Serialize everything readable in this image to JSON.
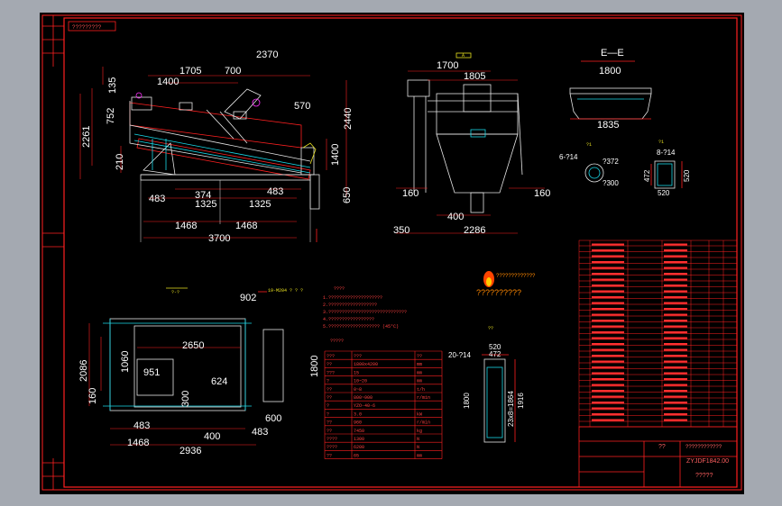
{
  "drawing": {
    "top_left_label": "?????????",
    "drawing_no": "ZYJDF1842.00",
    "title_question": "??",
    "company_question": "????????????",
    "bottom_question": "?????",
    "logo_caption": "??????????",
    "logo_top": "?????????????",
    "tech_title": "????",
    "tech_lines": [
      "1.????????????????????",
      "2.??????????????????",
      "3.?????????????????????????????",
      "4.?????????????????",
      "5.???????????????????  (45°C)"
    ],
    "params_title": "?????",
    "params_rows": [
      [
        "???",
        "???",
        "??"
      ],
      [
        "??",
        "1800x4200",
        "mm"
      ],
      [
        "???",
        "15",
        "mm"
      ],
      [
        "?",
        "10~20",
        "mm"
      ],
      [
        "??",
        "0~8",
        "t/h"
      ],
      [
        "??",
        "800~900",
        "r/min"
      ],
      [
        "?",
        "YZO-40-6",
        ""
      ],
      [
        "?",
        "3.0",
        "kW"
      ],
      [
        "??",
        "960",
        "r/min"
      ],
      [
        "??",
        "7450",
        "kg"
      ],
      [
        "????",
        "1300",
        "N"
      ],
      [
        "????",
        "6200",
        "N"
      ],
      [
        "??",
        "65",
        "mm"
      ]
    ]
  },
  "views": {
    "main_dims": [
      "1400",
      "1705",
      "700",
      "2370",
      "135",
      "752",
      "2261",
      "210",
      "570",
      "2440",
      "1400",
      "650",
      "483",
      "374",
      "1325",
      "1325",
      "483",
      "1468",
      "1468",
      "3700"
    ],
    "side_title": "A",
    "side_dims": [
      "1700",
      "1805",
      "160",
      "160",
      "400",
      "350",
      "2286"
    ],
    "ee_title": "E—E",
    "ee_dims": [
      "1800",
      "1835"
    ],
    "detail_titles": [
      "?1",
      "?1",
      "?2"
    ],
    "detail_dims": [
      "6-?14",
      "?372",
      "?300",
      "8-?14",
      "472",
      "520",
      "520"
    ],
    "plan_title": "?-?",
    "plan_note": "19-M204 ? ? ?",
    "plan_dims": [
      "902",
      "2650",
      "951",
      "624",
      "300",
      "1060",
      "2086",
      "160",
      "1800",
      "483",
      "400",
      "600",
      "483",
      "1468",
      "2936"
    ],
    "right_box_title": "??",
    "right_box_dims": [
      "20-?14",
      "520",
      "472",
      "1800",
      "23x8=1864",
      "1916"
    ]
  },
  "colors": {
    "background": "#000000",
    "frame": "#ff2020",
    "dimension_text": "#ffffff",
    "cyan_lines": "#18d8e8",
    "magenta": "#ff30ff"
  }
}
